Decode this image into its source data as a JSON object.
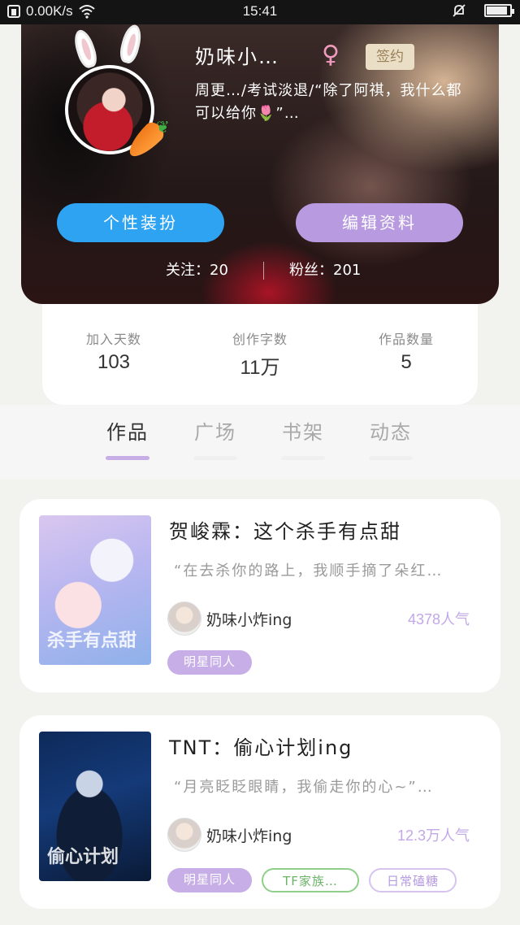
{
  "statusbar": {
    "speed": "0.00K/s",
    "time": "15:41",
    "battery_level": 0.9
  },
  "profile": {
    "username": "奶味小…",
    "gender_symbol": "♀",
    "sign_badge": "签约",
    "bio": "周更…/考试淡退/“除了阿祺，我什么都可以给你🌷”…",
    "dress_button": "个性装扮",
    "edit_button": "编辑资料",
    "follow_label": "关注：20",
    "fans_label": "粉丝：201"
  },
  "stats": [
    {
      "label": "加入天数",
      "value": "103"
    },
    {
      "label": "创作字数",
      "value": "11万"
    },
    {
      "label": "作品数量",
      "value": "5"
    }
  ],
  "tabs": [
    {
      "label": "作品",
      "active": true
    },
    {
      "label": "广场",
      "active": false
    },
    {
      "label": "书架",
      "active": false
    },
    {
      "label": "动态",
      "active": false
    }
  ],
  "works": [
    {
      "title": "贺峻霖：这个杀手有点甜",
      "desc": "“在去杀你的路上，我顺手摘了朵红…",
      "author": "奶味小炸ing",
      "popularity": "4378人气",
      "cover_text": "杀手有点甜",
      "tags": [
        "明星同人"
      ]
    },
    {
      "title": "TNT：偷心计划ing",
      "desc": "“月亮眨眨眼睛，我偷走你的心~”…",
      "author": "奶味小炸ing",
      "popularity": "12.3万人气",
      "cover_text": "偷心计划",
      "tags": [
        "明星同人",
        "TF家族…",
        "日常磕糖"
      ]
    }
  ],
  "colors": {
    "accent_purple": "#c7aee6",
    "accent_blue": "#2da3f2",
    "tag_green": "#8fcf8a"
  }
}
